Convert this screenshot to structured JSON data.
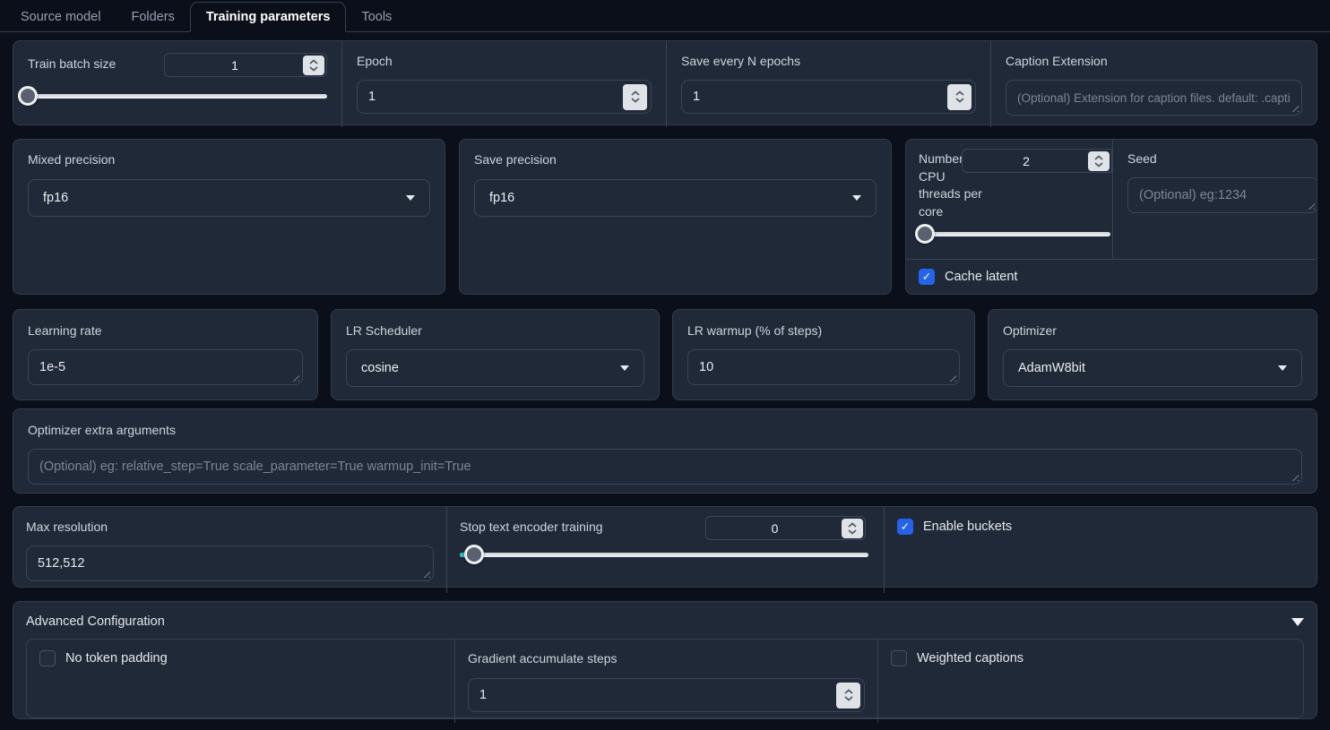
{
  "tabs": {
    "items": [
      {
        "label": "Source model",
        "active": false
      },
      {
        "label": "Folders",
        "active": false
      },
      {
        "label": "Training parameters",
        "active": true
      },
      {
        "label": "Tools",
        "active": false
      }
    ]
  },
  "basic": {
    "train_batch_size": {
      "label": "Train batch size",
      "value": "1",
      "slider_percent": 0
    },
    "epoch": {
      "label": "Epoch",
      "value": "1"
    },
    "save_every_n_epochs": {
      "label": "Save every N epochs",
      "value": "1"
    },
    "caption_extension": {
      "label": "Caption Extension",
      "placeholder": "(Optional) Extension for caption files. default: .caption"
    }
  },
  "precision": {
    "mixed_precision": {
      "label": "Mixed precision",
      "value": "fp16"
    },
    "save_precision": {
      "label": "Save precision",
      "value": "fp16"
    },
    "cpu_threads": {
      "label": "Number of CPU threads per core",
      "value": "2",
      "slider_percent": 3.5
    },
    "seed": {
      "label": "Seed",
      "placeholder": "(Optional) eg:1234"
    },
    "cache_latent": {
      "label": "Cache latent",
      "checked": true
    }
  },
  "learning": {
    "learning_rate": {
      "label": "Learning rate",
      "value": "1e-5"
    },
    "lr_scheduler": {
      "label": "LR Scheduler",
      "value": "cosine"
    },
    "lr_warmup": {
      "label": "LR warmup (% of steps)",
      "value": "10"
    },
    "optimizer": {
      "label": "Optimizer",
      "value": "AdamW8bit"
    }
  },
  "optimizer_args": {
    "label": "Optimizer extra arguments",
    "placeholder": "(Optional) eg: relative_step=True scale_parameter=True warmup_init=True"
  },
  "resolution": {
    "max_resolution": {
      "label": "Max resolution",
      "value": "512,512"
    },
    "stop_text_encoder": {
      "label": "Stop text encoder training",
      "value": "0",
      "slider_percent": 3.5
    },
    "enable_buckets": {
      "label": "Enable buckets",
      "checked": true
    }
  },
  "advanced": {
    "title": "Advanced Configuration",
    "no_token_padding": {
      "label": "No token padding",
      "checked": false
    },
    "gradient_accumulate_steps": {
      "label": "Gradient accumulate steps",
      "value": "1"
    },
    "weighted_captions": {
      "label": "Weighted captions",
      "checked": false
    }
  },
  "colors": {
    "background": "#0b0f19",
    "panel": "#1f2937",
    "border": "#374151",
    "checkbox_accent": "#2563eb",
    "slider_fill": "#22c0c7",
    "slider_track": "#e5e7eb",
    "label_text": "#cfd5dd",
    "placeholder_text": "#7d8695"
  }
}
